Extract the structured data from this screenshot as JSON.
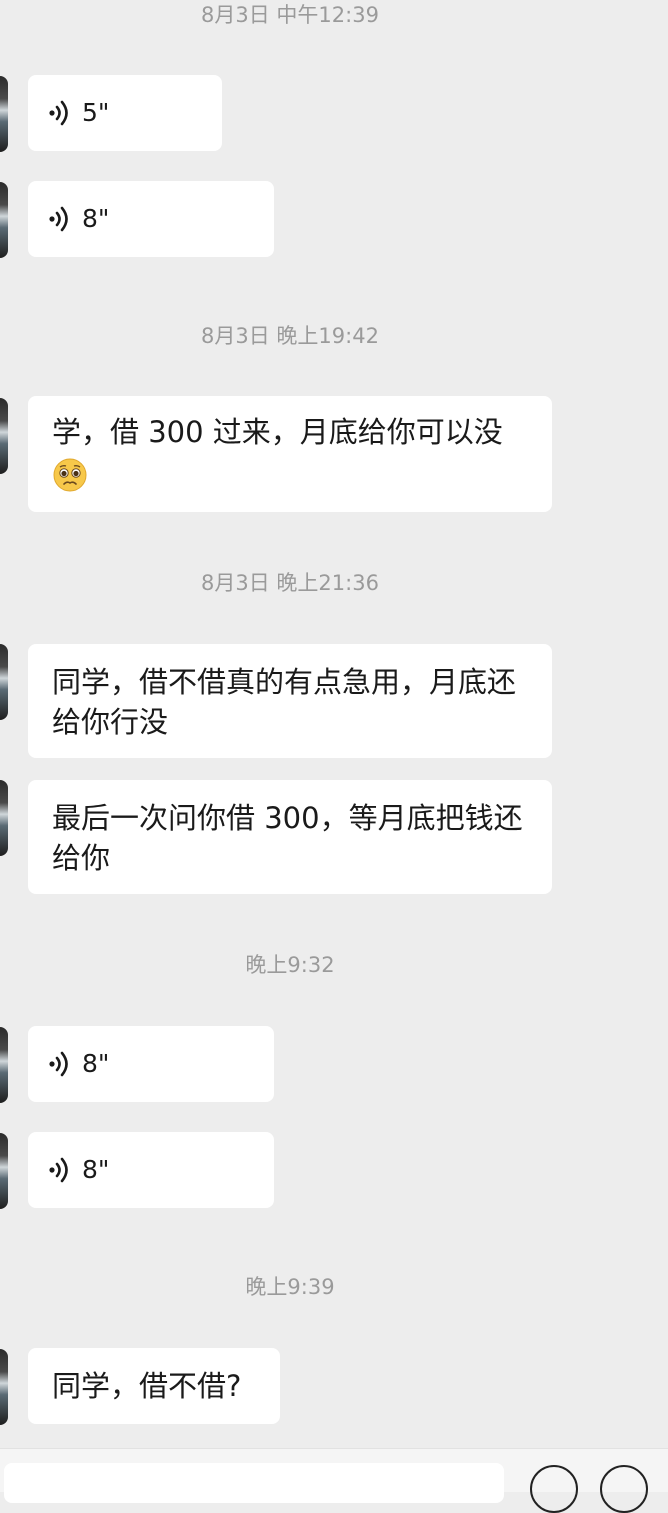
{
  "messages": {
    "ts1": "8月3日 中午12:39",
    "voice1": "5\"",
    "voice2": "8\"",
    "ts2": "8月3日 晚上19:42",
    "text1_line1": "学，借 300 过来，月底给你可以没",
    "text1_emoji": "pleading-face-emoji",
    "ts3": "8月3日 晚上21:36",
    "text2": "同学，借不借真的有点急用，月底还给你行没",
    "text3": "最后一次问你借 300，等月底把钱还给你",
    "ts4": "晚上9:32",
    "voice3": "8\"",
    "voice4": "8\"",
    "ts5": "晚上9:39",
    "text4": "同学，借不借?"
  },
  "colors": {
    "background": "#ededed",
    "bubble": "#ffffff",
    "timestamp": "#9a9a9a",
    "text": "#1a1a1a"
  }
}
